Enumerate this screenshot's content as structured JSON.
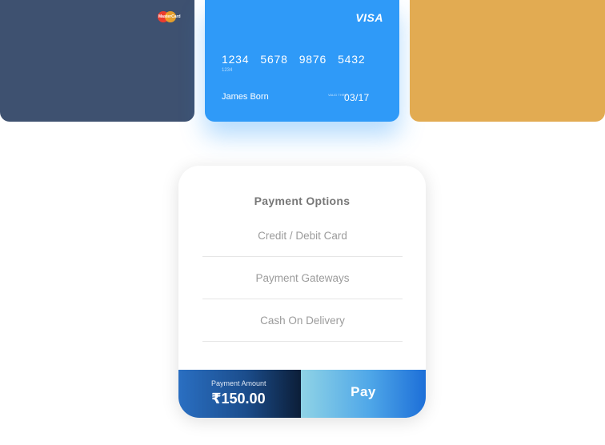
{
  "cards": {
    "left": {
      "brand_logo": "MasterCard",
      "color": "#3e5170"
    },
    "middle": {
      "brand": "VISA",
      "number_groups": [
        "1234",
        "5678",
        "9876",
        "5432"
      ],
      "number_sub": "1234",
      "holder": "James Born",
      "valid_label": "VALID THRU",
      "expiry": "03/17",
      "color": "#2f9af8"
    },
    "right": {
      "color": "#e2ab52"
    }
  },
  "payment": {
    "title": "Payment Options",
    "options": [
      "Credit / Debit Card",
      "Payment Gateways",
      "Cash On Delivery"
    ],
    "amount_label": "Payment Amount",
    "amount": "₹150.00",
    "pay_label": "Pay"
  }
}
